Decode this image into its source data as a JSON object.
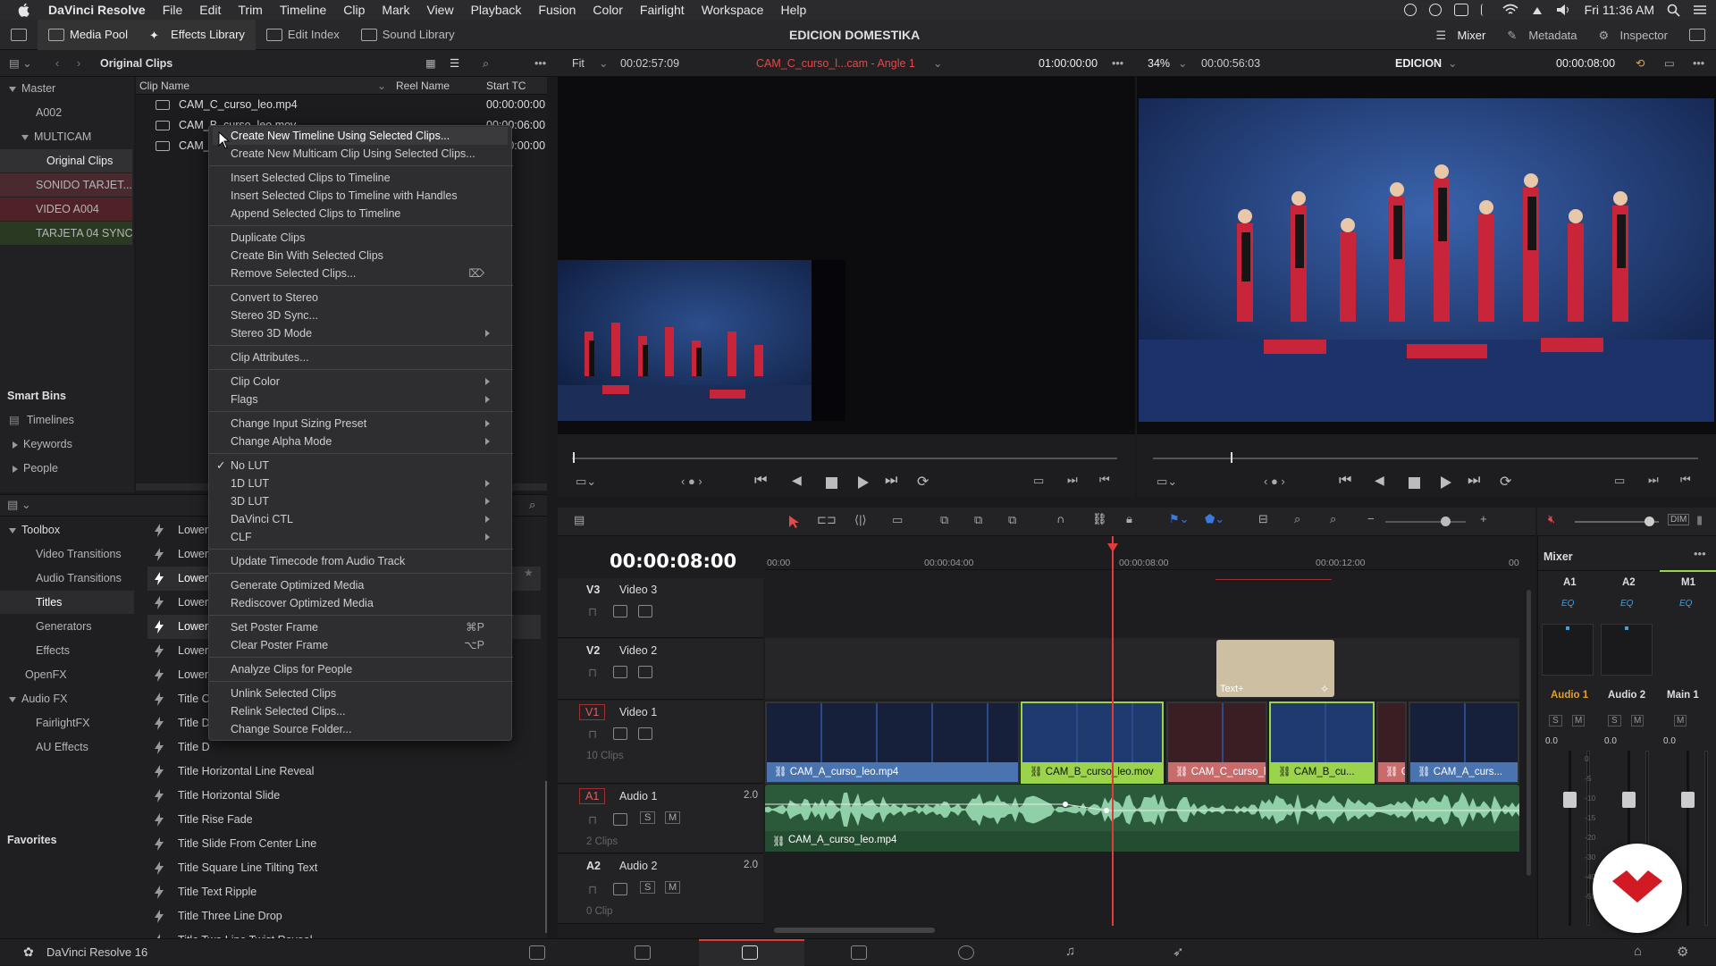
{
  "menubar": {
    "items": [
      "DaVinci Resolve",
      "File",
      "Edit",
      "Trim",
      "Timeline",
      "Clip",
      "Mark",
      "View",
      "Playback",
      "Fusion",
      "Color",
      "Fairlight",
      "Workspace",
      "Help"
    ],
    "clock": "Fri 11:36 AM"
  },
  "toolbar": {
    "media_pool": "Media Pool",
    "effects_library": "Effects Library",
    "edit_index": "Edit Index",
    "sound_library": "Sound Library",
    "project_title": "EDICION DOMESTIKA",
    "mixer": "Mixer",
    "metadata": "Metadata",
    "inspector": "Inspector"
  },
  "subbar": {
    "bin_title": "Original Clips",
    "fit": "Fit",
    "src_timecode": "00:02:57:09",
    "src_clip": "CAM_C_curso_l...cam - Angle 1",
    "src_tc2": "01:00:00:00",
    "zoom": "34%",
    "prg_timecode": "00:00:56:03",
    "timeline_name": "EDICION",
    "prg_tc2": "00:00:08:00"
  },
  "bins": {
    "master": "Master",
    "a002": "A002",
    "multicam": "MULTICAM",
    "original": "Original Clips",
    "sonido": "SONIDO TARJET...",
    "video": "VIDEO A004",
    "tarjeta": "TARJETA 04 SYNC",
    "colors": {
      "sonido": "#4a2a2e",
      "video": "#4e2226",
      "tarjeta": "#2a3a22"
    }
  },
  "smart_bins": {
    "title": "Smart Bins",
    "items": [
      "Timelines",
      "Keywords",
      "People"
    ]
  },
  "cliplist": {
    "headers": {
      "name": "Clip Name",
      "reel": "Reel Name",
      "start": "Start TC"
    },
    "rows": [
      {
        "name": "CAM_C_curso_leo.mp4",
        "tc": "00:00:00:00"
      },
      {
        "name": "CAM_B_curso_leo.mov",
        "tc": "00:00:06:00"
      },
      {
        "name": "CAM_A_curso_leo.mp4",
        "tc": "00:00:00:00"
      }
    ]
  },
  "context_menu": {
    "items": [
      "Create New Timeline Using Selected Clips...",
      "Create New Multicam Clip Using Selected Clips...",
      "Insert Selected Clips to Timeline",
      "Insert Selected Clips to Timeline with Handles",
      "Append Selected Clips to Timeline",
      "Duplicate Clips",
      "Create Bin With Selected Clips",
      "Remove Selected Clips...",
      "Convert to Stereo",
      "Stereo 3D Sync...",
      "Stereo 3D Mode",
      "Clip Attributes...",
      "Clip Color",
      "Flags",
      "Change Input Sizing Preset",
      "Change Alpha Mode",
      "No LUT",
      "1D LUT",
      "3D LUT",
      "DaVinci CTL",
      "CLF",
      "Update Timecode from Audio Track",
      "Generate Optimized Media",
      "Rediscover Optimized Media",
      "Set Poster Frame",
      "Clear Poster Frame",
      "Analyze Clips for People",
      "Unlink Selected Clips",
      "Relink Selected Clips...",
      "Change Source Folder..."
    ],
    "shortcuts": {
      "set_poster": "⌘P",
      "clear_poster": "⌥P"
    }
  },
  "fx": {
    "toolbox": "Toolbox",
    "video_transitions": "Video Transitions",
    "audio_transitions": "Audio Transitions",
    "titles": "Titles",
    "generators": "Generators",
    "effects": "Effects",
    "openfx": "OpenFX",
    "audio_fx": "Audio FX",
    "fairlight_fx": "FairlightFX",
    "au_effects": "AU Effects",
    "favorites": "Favorites",
    "items": [
      "Lower",
      "Lower",
      "Lower",
      "Lower",
      "Lower",
      "Lower",
      "Lower",
      "Title C",
      "Title D",
      "Title D",
      "Title Horizontal Line Reveal",
      "Title Horizontal Slide",
      "Title Rise Fade",
      "Title Slide From Center Line",
      "Title Square Line Tilting Text",
      "Title Text Ripple",
      "Title Three Line Drop",
      "Title Two Line Twist Reveal"
    ]
  },
  "timeline": {
    "timecode": "00:00:08:00",
    "ruler": [
      "00:00",
      "00:00:04:00",
      "00:00:08:00",
      "00:00:12:00",
      "00"
    ],
    "tracks": {
      "v3": {
        "id": "V3",
        "name": "Video 3"
      },
      "v2": {
        "id": "V2",
        "name": "Video 2"
      },
      "v1": {
        "id": "V1",
        "name": "Video 1",
        "info": "10 Clips"
      },
      "a1": {
        "id": "A1",
        "name": "Audio 1",
        "level": "2.0",
        "info": "2 Clips"
      },
      "a2": {
        "id": "A2",
        "name": "Audio 2",
        "level": "2.0",
        "info": "0 Clip"
      }
    },
    "text_clip": "Text+",
    "video_clips": [
      "CAM_A_curso_leo.mp4",
      "CAM_B_curso_leo.mov",
      "CAM_C_curso_leo....",
      "CAM_B_cu...",
      "CA...",
      "CAM_A_curs..."
    ],
    "audio_clip": "CAM_A_curso_leo.mp4",
    "sm": {
      "s": "S",
      "m": "M"
    }
  },
  "mixer": {
    "title": "Mixer",
    "ch": [
      "A1",
      "A2",
      "M1"
    ],
    "eq": "EQ",
    "buses": [
      "Audio 1",
      "Audio 2",
      "Main 1"
    ],
    "vals": [
      "0.0",
      "0.0",
      "0.0"
    ],
    "scale": [
      "0",
      "-5",
      "-10",
      "-15",
      "-20",
      "-30",
      "-40",
      "-50"
    ]
  },
  "bottom": {
    "app_name": "DaVinci Resolve 16"
  }
}
